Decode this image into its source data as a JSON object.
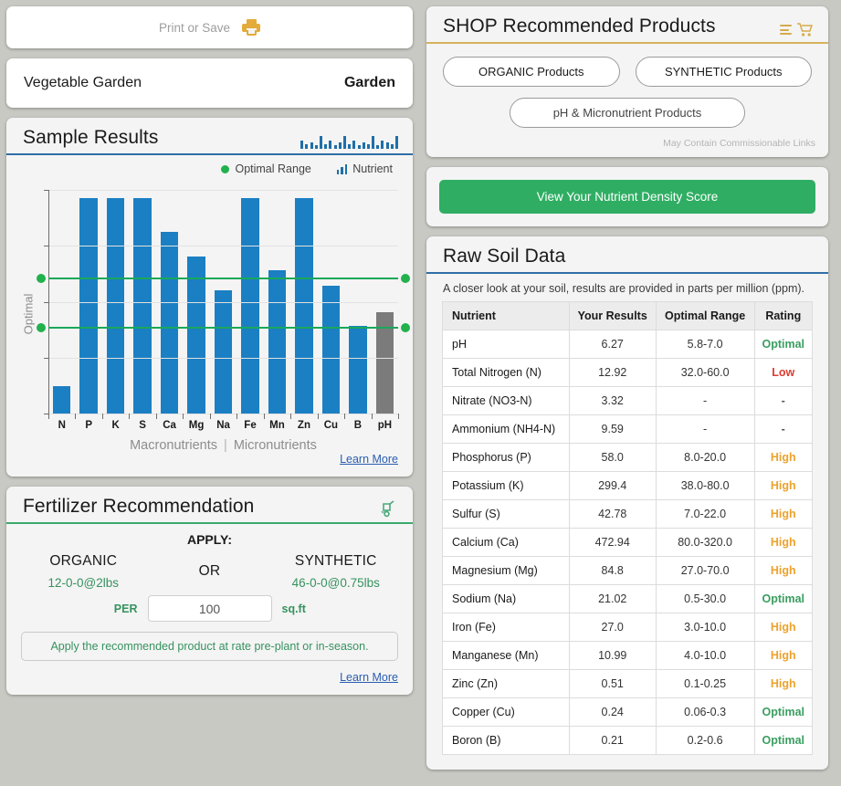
{
  "print_bar": {
    "label": "Print or Save",
    "icon": "printer-icon"
  },
  "garden_bar": {
    "name": "Vegetable Garden",
    "type": "Garden"
  },
  "sample_results": {
    "title": "Sample Results",
    "legend": [
      {
        "label": "Optimal Range",
        "icon": "green-dot-icon",
        "color": "#22b14c"
      },
      {
        "label": "Nutrient",
        "icon": "bar-chart-icon",
        "color": "#1f6fa8"
      }
    ],
    "learn_more": "Learn More"
  },
  "chart_data": {
    "type": "bar",
    "title": "Sample Results",
    "xlabel": "",
    "ylabel": "Optimal",
    "categories": [
      "N",
      "P",
      "K",
      "S",
      "Ca",
      "Mg",
      "Na",
      "Fe",
      "Mn",
      "Zn",
      "Cu",
      "B",
      "pH"
    ],
    "values": [
      12,
      96,
      96,
      96,
      81,
      70,
      55,
      96,
      64,
      96,
      57,
      39,
      45
    ],
    "bar_colors": [
      "#1b7fc3",
      "#1b7fc3",
      "#1b7fc3",
      "#1b7fc3",
      "#1b7fc3",
      "#1b7fc3",
      "#1b7fc3",
      "#1b7fc3",
      "#1b7fc3",
      "#1b7fc3",
      "#1b7fc3",
      "#1b7fc3",
      "#7b7b7b"
    ],
    "ylim": [
      0,
      100
    ],
    "grid": true,
    "legend_position": "top-right",
    "optimal_band": {
      "upper": 61,
      "lower": 39,
      "color": "#19a85a"
    },
    "group_labels": {
      "left": "Macronutrients",
      "separator": "|",
      "right": "Micronutrients"
    },
    "annotations": [
      "Optimal Range band drawn as two green horizontal lines with round end caps"
    ]
  },
  "fertilizer": {
    "title": "Fertilizer Recommendation",
    "icon": "spreader-cart-icon",
    "apply_label": "APPLY:",
    "organic_header": "ORGANIC",
    "or_label": "OR",
    "synthetic_header": "SYNTHETIC",
    "organic_rate": "12-0-0@2lbs",
    "synthetic_rate": "46-0-0@0.75lbs",
    "per_label": "PER",
    "area_value": "100",
    "area_placeholder": "100",
    "area_unit": "sq.ft",
    "note": "Apply the recommended product at rate pre-plant or in-season.",
    "learn_more": "Learn More"
  },
  "shop": {
    "title": "SHOP Recommended Products",
    "icons": [
      "list-icon",
      "shopping-cart-icon"
    ],
    "buttons": [
      "ORGANIC Products",
      "SYNTHETIC Products",
      "pH & Micronutrient Products"
    ],
    "disclaimer": "May Contain Commissionable Links"
  },
  "score": {
    "button_label": "View Your Nutrient Density Score",
    "color": "#2fae63"
  },
  "raw_soil": {
    "title": "Raw Soil Data",
    "subtitle": "A closer look at your soil, results are provided in parts per million (ppm).",
    "columns": [
      "Nutrient",
      "Your Results",
      "Optimal Range",
      "Rating"
    ],
    "rows": [
      {
        "nutrient": "pH",
        "result": "6.27",
        "range": "5.8-7.0",
        "rating": "Optimal",
        "rating_class": "r-optimal"
      },
      {
        "nutrient": "Total Nitrogen (N)",
        "result": "12.92",
        "range": "32.0-60.0",
        "rating": "Low",
        "rating_class": "r-low"
      },
      {
        "nutrient": "Nitrate (NO3-N)",
        "result": "3.32",
        "range": "-",
        "rating": "-",
        "rating_class": "r-none"
      },
      {
        "nutrient": "Ammonium (NH4-N)",
        "result": "9.59",
        "range": "-",
        "rating": "-",
        "rating_class": "r-none"
      },
      {
        "nutrient": "Phosphorus (P)",
        "result": "58.0",
        "range": "8.0-20.0",
        "rating": "High",
        "rating_class": "r-high"
      },
      {
        "nutrient": "Potassium (K)",
        "result": "299.4",
        "range": "38.0-80.0",
        "rating": "High",
        "rating_class": "r-high"
      },
      {
        "nutrient": "Sulfur (S)",
        "result": "42.78",
        "range": "7.0-22.0",
        "rating": "High",
        "rating_class": "r-high"
      },
      {
        "nutrient": "Calcium (Ca)",
        "result": "472.94",
        "range": "80.0-320.0",
        "rating": "High",
        "rating_class": "r-high"
      },
      {
        "nutrient": "Magnesium (Mg)",
        "result": "84.8",
        "range": "27.0-70.0",
        "rating": "High",
        "rating_class": "r-high"
      },
      {
        "nutrient": "Sodium (Na)",
        "result": "21.02",
        "range": "0.5-30.0",
        "rating": "Optimal",
        "rating_class": "r-optimal"
      },
      {
        "nutrient": "Iron (Fe)",
        "result": "27.0",
        "range": "3.0-10.0",
        "rating": "High",
        "rating_class": "r-high"
      },
      {
        "nutrient": "Manganese (Mn)",
        "result": "10.99",
        "range": "4.0-10.0",
        "rating": "High",
        "rating_class": "r-high"
      },
      {
        "nutrient": "Zinc (Zn)",
        "result": "0.51",
        "range": "0.1-0.25",
        "rating": "High",
        "rating_class": "r-high"
      },
      {
        "nutrient": "Copper (Cu)",
        "result": "0.24",
        "range": "0.06-0.3",
        "rating": "Optimal",
        "rating_class": "r-optimal"
      },
      {
        "nutrient": "Boron (B)",
        "result": "0.21",
        "range": "0.2-0.6",
        "rating": "Optimal",
        "rating_class": "r-optimal"
      }
    ]
  }
}
